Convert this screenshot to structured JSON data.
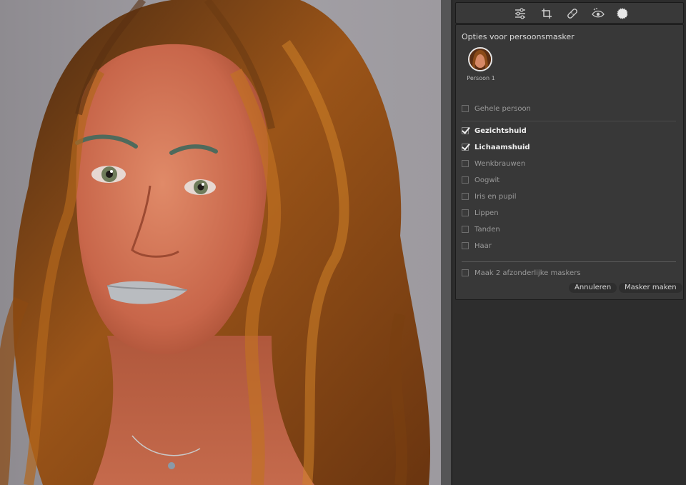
{
  "toolbar": {
    "tools": [
      {
        "icon": "sliders-icon"
      },
      {
        "icon": "crop-icon"
      },
      {
        "icon": "healing-bandage-icon"
      },
      {
        "icon": "red-eye-icon"
      },
      {
        "icon": "masking-icon",
        "active": true
      }
    ]
  },
  "dialog": {
    "title": "Opties voor persoonsmasker",
    "person": {
      "label": "Persoon 1"
    },
    "whole_person": {
      "label": "Gehele persoon",
      "checked": false
    },
    "options": [
      {
        "label": "Gezichtshuid",
        "checked": true
      },
      {
        "label": "Lichaamshuid",
        "checked": true
      },
      {
        "label": "Wenkbrauwen",
        "checked": false
      },
      {
        "label": "Oogwit",
        "checked": false
      },
      {
        "label": "Iris en pupil",
        "checked": false
      },
      {
        "label": "Lippen",
        "checked": false
      },
      {
        "label": "Tanden",
        "checked": false
      },
      {
        "label": "Haar",
        "checked": false
      }
    ],
    "separate_masks": {
      "label": "Maak 2 afzonderlijke maskers",
      "checked": false
    },
    "cancel_label": "Annuleren",
    "create_label": "Masker maken"
  },
  "colors": {
    "panel_bg": "#2d2d2d",
    "dialog_bg": "#383838",
    "hair": "#8a4a14",
    "skin_overlay": "#d4704a"
  }
}
